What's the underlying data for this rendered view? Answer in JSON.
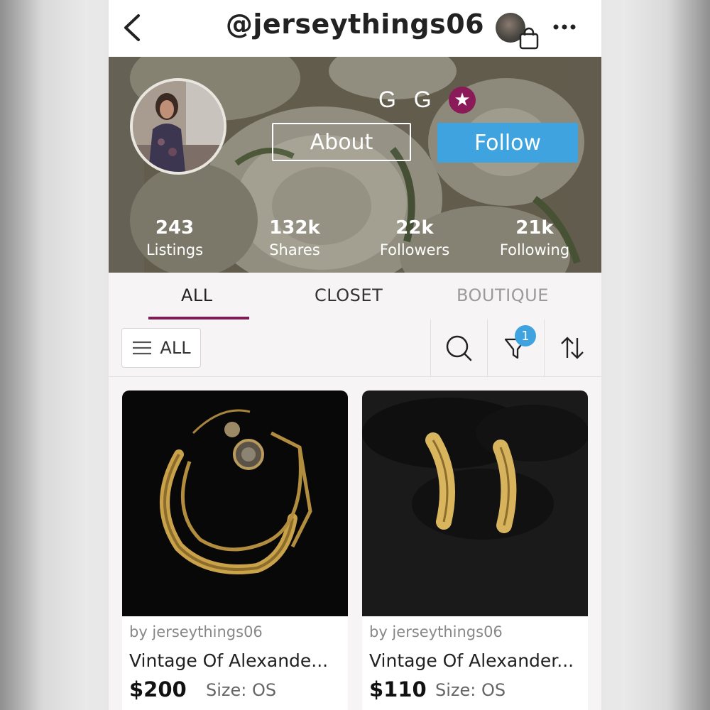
{
  "header": {
    "handle": "@jerseythings06",
    "back_icon": "chevron-left-icon",
    "bag_icon": "shopping-bag-icon",
    "more_icon": "more-dots-icon"
  },
  "profile": {
    "display_name": "G G",
    "badge_icon": "star-icon",
    "about_label": "About",
    "follow_label": "Follow",
    "stats": [
      {
        "value": "243",
        "label": "Listings"
      },
      {
        "value": "132k",
        "label": "Shares"
      },
      {
        "value": "22k",
        "label": "Followers"
      },
      {
        "value": "21k",
        "label": "Following"
      }
    ]
  },
  "tabs": [
    {
      "label": "ALL",
      "active": true
    },
    {
      "label": "CLOSET",
      "active": false
    },
    {
      "label": "BOUTIQUE",
      "active": false
    }
  ],
  "filters": {
    "all_label": "ALL",
    "filter_count": "1"
  },
  "listings": [
    {
      "seller": "by jerseythings06",
      "title": "Vintage Of  Alexande...",
      "price": "$200",
      "size": "Size: OS"
    },
    {
      "seller": "by jerseythings06",
      "title": "Vintage Of Alexander...",
      "price": "$110",
      "size": "Size: OS"
    }
  ],
  "colors": {
    "accent_blue": "#3ea3df",
    "brand_magenta": "#7e1d54",
    "badge_purple": "#8a1a58"
  }
}
